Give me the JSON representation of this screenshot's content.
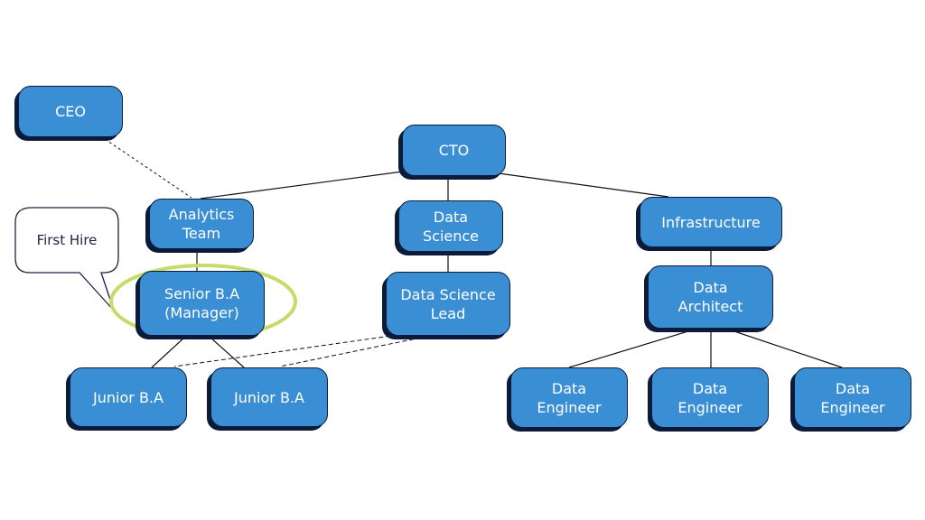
{
  "diagram": {
    "type": "org-chart",
    "node_color": "#3a8fd4",
    "shadow_color": "#0d1b3a",
    "highlight_color": "#c5dc6a",
    "nodes": {
      "ceo": "CEO",
      "cto": "CTO",
      "analytics_team": "Analytics\nTeam",
      "data_science": "Data\nScience",
      "infrastructure": "Infrastructure",
      "senior_ba": "Senior B.A\n(Manager)",
      "data_science_lead": "Data Science\nLead",
      "data_architect": "Data\nArchitect",
      "junior_ba_1": "Junior B.A",
      "junior_ba_2": "Junior B.A",
      "data_engineer_1": "Data\nEngineer",
      "data_engineer_2": "Data\nEngineer",
      "data_engineer_3": "Data\nEngineer"
    },
    "callout": {
      "label": "First Hire",
      "points_to": "senior_ba"
    },
    "edges": [
      {
        "from": "cto",
        "to": "analytics_team",
        "style": "solid"
      },
      {
        "from": "cto",
        "to": "data_science",
        "style": "solid"
      },
      {
        "from": "cto",
        "to": "infrastructure",
        "style": "solid"
      },
      {
        "from": "ceo",
        "to": "analytics_team",
        "style": "dashed"
      },
      {
        "from": "analytics_team",
        "to": "senior_ba",
        "style": "solid"
      },
      {
        "from": "data_science",
        "to": "data_science_lead",
        "style": "solid"
      },
      {
        "from": "infrastructure",
        "to": "data_architect",
        "style": "solid"
      },
      {
        "from": "senior_ba",
        "to": "junior_ba_1",
        "style": "solid"
      },
      {
        "from": "senior_ba",
        "to": "junior_ba_2",
        "style": "solid"
      },
      {
        "from": "data_science_lead",
        "to": "junior_ba_1",
        "style": "dashed"
      },
      {
        "from": "data_science_lead",
        "to": "junior_ba_2",
        "style": "dashed"
      },
      {
        "from": "data_architect",
        "to": "data_engineer_1",
        "style": "solid"
      },
      {
        "from": "data_architect",
        "to": "data_engineer_2",
        "style": "solid"
      },
      {
        "from": "data_architect",
        "to": "data_engineer_3",
        "style": "solid"
      }
    ]
  }
}
